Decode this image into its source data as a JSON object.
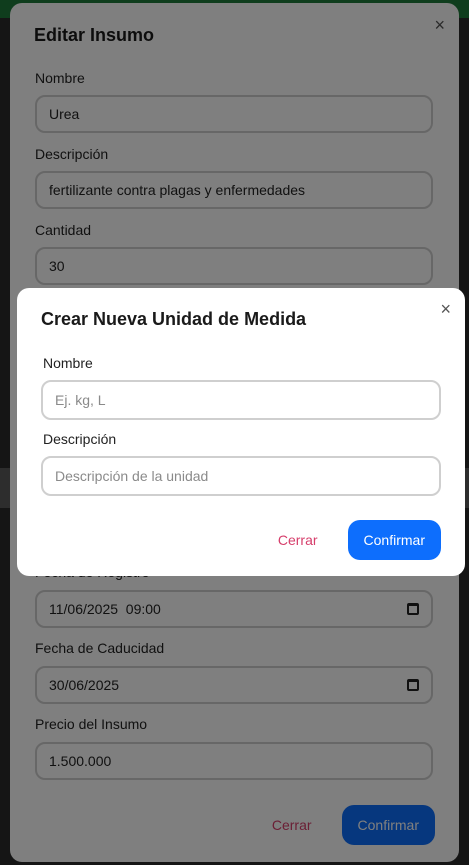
{
  "edit_modal": {
    "title": "Editar Insumo",
    "close_icon": "×",
    "fields": {
      "nombre": {
        "label": "Nombre",
        "value": "Urea"
      },
      "descripcion": {
        "label": "Descripción",
        "value": "fertilizante contra plagas y enfermedades"
      },
      "cantidad": {
        "label": "Cantidad",
        "value": "30"
      },
      "fecha_registro": {
        "label": "Fecha de Registro",
        "value": "11/06/2025  09:00"
      },
      "fecha_caducidad": {
        "label": "Fecha de Caducidad",
        "value": "30/06/2025"
      },
      "precio": {
        "label": "Precio del Insumo",
        "value": "1.500.000"
      }
    },
    "cancel_label": "Cerrar",
    "confirm_label": "Confirmar"
  },
  "create_modal": {
    "title": "Crear Nueva Unidad de Medida",
    "close_icon": "×",
    "nombre_label": "Nombre",
    "nombre_placeholder": "Ej. kg, L",
    "descripcion_label": "Descripción",
    "descripcion_placeholder": "Descripción de la unidad",
    "cancel_label": "Cerrar",
    "confirm_label": "Confirmar"
  },
  "colors": {
    "primary": "#0d6efd",
    "cancel": "#d63e6b",
    "topbar": "#1f7a3a"
  }
}
